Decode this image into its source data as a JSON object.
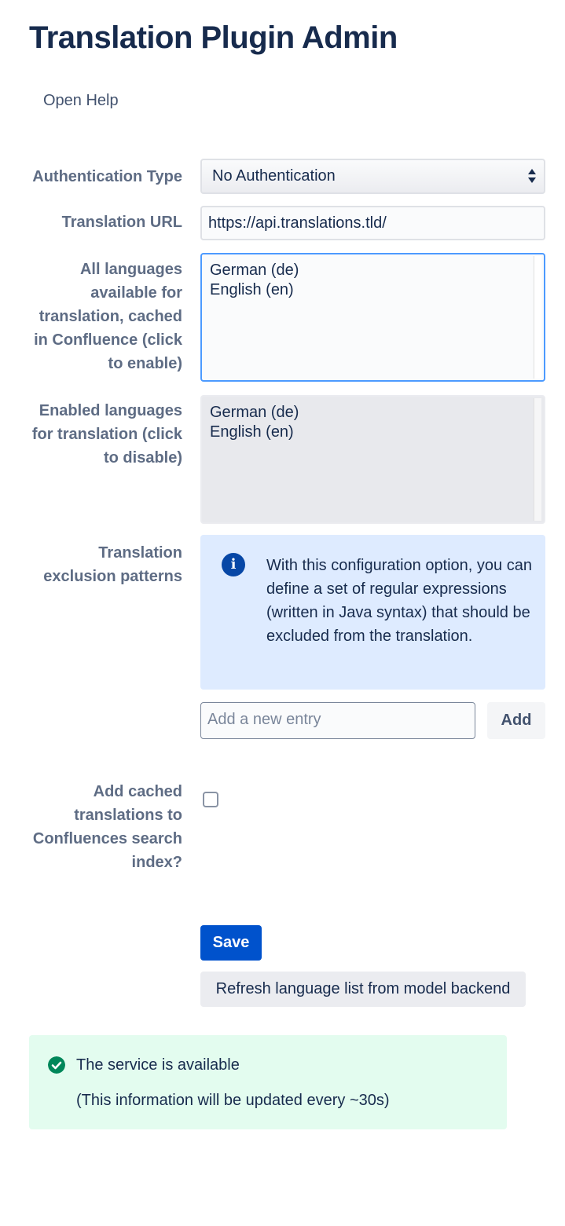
{
  "page": {
    "title": "Translation Plugin Admin",
    "help_link": "Open Help"
  },
  "form": {
    "auth_type": {
      "label": "Authentication Type",
      "value": "No Authentication"
    },
    "translation_url": {
      "label": "Translation URL",
      "value": "https://api.translations.tld/"
    },
    "available_languages": {
      "label": "All languages available for translation, cached in Confluence (click to enable)",
      "options": [
        "German (de)",
        "English (en)"
      ]
    },
    "enabled_languages": {
      "label": "Enabled languages for translation (click to disable)",
      "options": [
        "German (de)",
        "English (en)"
      ]
    },
    "exclusion_patterns": {
      "label": "Translation exclusion patterns",
      "info_icon": "info-icon",
      "info_text": "With this configuration option, you can define a set of regular expressions (written in Java syntax) that should be excluded from the translation.",
      "entry_placeholder": "Add a new entry",
      "add_label": "Add"
    },
    "search_index": {
      "label": "Add cached translations to Confluences search index?",
      "checked": false
    },
    "save_label": "Save",
    "refresh_label": "Refresh language list from model backend"
  },
  "status": {
    "icon": "check-circle-icon",
    "title": "The service is available",
    "note": "(This information will be updated every ~30s)",
    "colors": {
      "background": "#e3fcef",
      "icon": "#00875a"
    }
  },
  "colors": {
    "primary_button": "#0052cc",
    "info_background": "#deebff",
    "focus_border": "#4c9aff"
  }
}
